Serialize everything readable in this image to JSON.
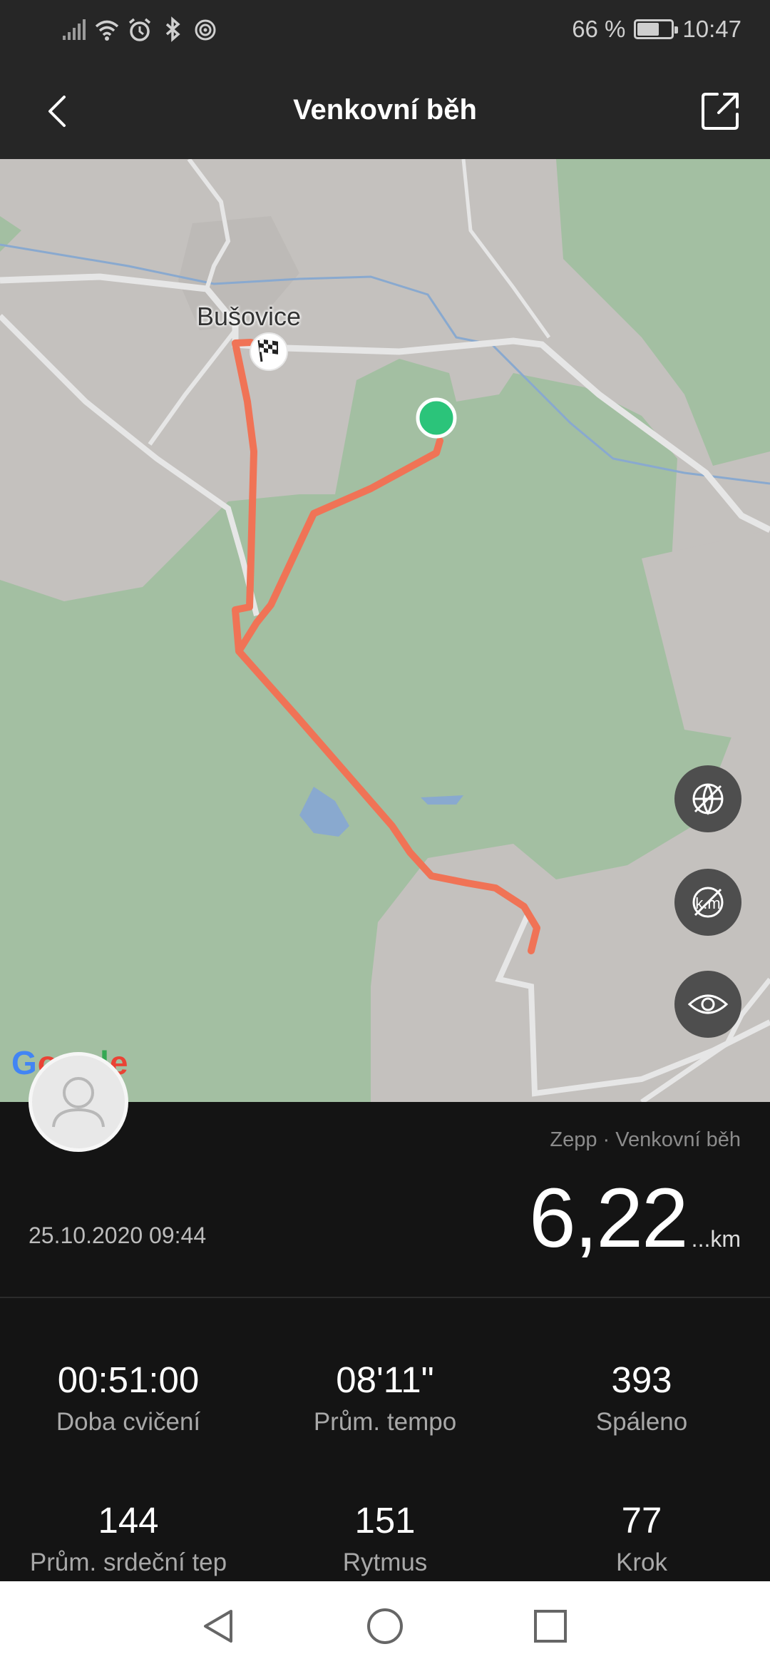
{
  "status_bar": {
    "battery_text": "66 %",
    "battery_level": 0.66,
    "time": "10:47",
    "icons": [
      "signal-icon",
      "wifi-icon",
      "alarm-icon",
      "bluetooth-icon",
      "nfc-icon",
      "battery-icon"
    ]
  },
  "header": {
    "title": "Venkovní běh",
    "back_icon": "back-arrow-icon",
    "share_icon": "share-icon"
  },
  "map": {
    "place_label": "Bušovice",
    "provider_logo": "Google",
    "controls": [
      "map-style-toggle-icon",
      "km-markers-toggle-icon",
      "visibility-icon"
    ],
    "route_color": "#f07356",
    "start_marker_color": "#2bc47a",
    "finish_marker_icon": "checkered-flag-icon"
  },
  "summary": {
    "source": "Zepp · Venkovní běh",
    "date": "25.10.2020 09:44",
    "distance_value": "6,22",
    "distance_unit": "...km"
  },
  "stats": [
    {
      "value": "00:51:00",
      "label": "Doba cvičení"
    },
    {
      "value": "08'11\"",
      "label": "Prům. tempo"
    },
    {
      "value": "393",
      "label": "Spáleno"
    },
    {
      "value": "144",
      "label": "Prům. srdeční tep"
    },
    {
      "value": "151",
      "label": "Rytmus"
    },
    {
      "value": "77",
      "label": "Krok"
    }
  ],
  "nav_bar": {
    "icons": [
      "nav-back-icon",
      "nav-home-icon",
      "nav-recents-icon"
    ]
  }
}
